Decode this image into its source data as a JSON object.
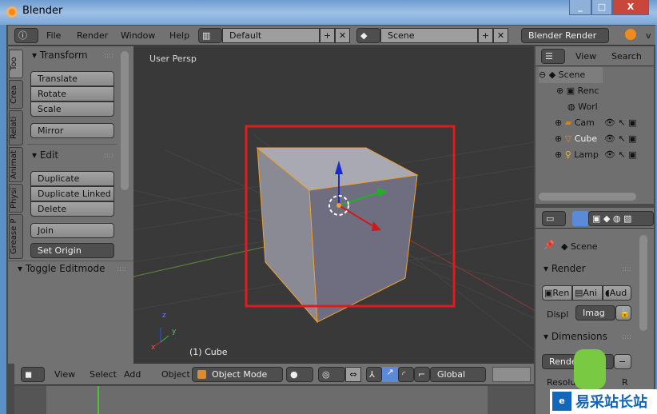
{
  "window": {
    "title": "Blender",
    "min": "_",
    "max": "□",
    "close": "X"
  },
  "info_header": {
    "menus": [
      "File",
      "Render",
      "Window",
      "Help"
    ],
    "layout": "Default",
    "scene": "Scene",
    "engine": "Blender Render",
    "version_partial": "v"
  },
  "tools": {
    "tabs": [
      "Too",
      "Crea",
      "Relati",
      "Animat",
      "Physi",
      "Grease P"
    ],
    "transform": {
      "title": "Transform",
      "buttons": [
        "Translate",
        "Rotate",
        "Scale"
      ],
      "mirror": "Mirror"
    },
    "edit": {
      "title": "Edit",
      "buttons": [
        "Duplicate",
        "Duplicate Linked",
        "Delete"
      ],
      "join": "Join",
      "set_origin": "Set Origin"
    },
    "toggle": "Toggle Editmode"
  },
  "viewport": {
    "view_label": "User Persp",
    "object_label": "(1) Cube",
    "axis_x": "x",
    "axis_y": "y",
    "axis_z": "z",
    "selection_color": "#e01b1b"
  },
  "view3d_header": {
    "menus": [
      "View",
      "Select",
      "Add",
      "Object"
    ],
    "mode": "Object Mode",
    "orientation": "Global"
  },
  "outliner": {
    "menus": [
      "View",
      "Search"
    ],
    "items": [
      {
        "label": "Scene"
      },
      {
        "label": "Renc"
      },
      {
        "label": "Worl"
      },
      {
        "label": "Cam"
      },
      {
        "label": "Cube"
      },
      {
        "label": "Lamp"
      }
    ]
  },
  "properties": {
    "context": "Scene",
    "render": {
      "title": "Render",
      "buttons": [
        "Ren",
        "Ani",
        "Aud"
      ],
      "display_label": "Displ",
      "display_value": "Imag"
    },
    "dimensions": {
      "title": "Dimensions",
      "preset": "Render P",
      "resolution": "Resolu",
      "r": "R"
    }
  },
  "watermark": {
    "text": "易采站长站"
  }
}
